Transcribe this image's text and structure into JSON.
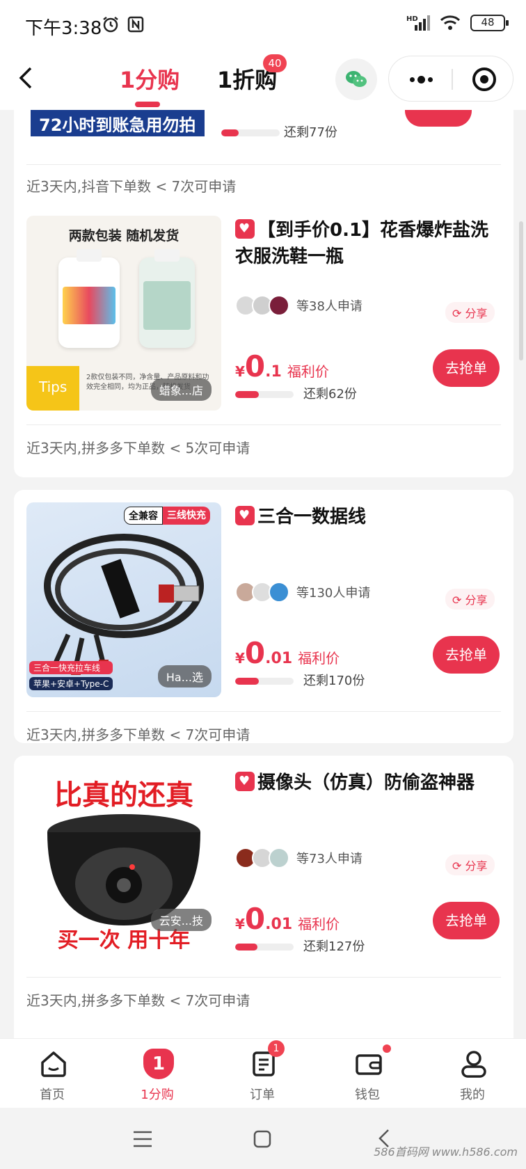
{
  "status_bar": {
    "time": "下午3:38",
    "battery": "48",
    "network": "HD"
  },
  "nav": {
    "tab_active": "1分购",
    "tab_other": "1折购",
    "tab_other_badge": "40"
  },
  "partial_card": {
    "banner_text": "72小时到账急用勿拍",
    "remaining": "还剩77份",
    "progress": 0.3,
    "condition": "近3天内,抖音下单数 < 7次可申请"
  },
  "products": [
    {
      "thumb_caption_top": "两款包装  随机发货",
      "thumb_tips": "Tips",
      "thumb_note": "2款仅包装不同，净含量、产品原料和功效完全相同，均为正品，随机发货",
      "shop": "蜡象...店",
      "title": "【到手价0.1】花香爆炸盐洗衣服洗鞋一瓶",
      "applicants": "等38人申请",
      "share": "分享",
      "price_yen": "¥",
      "price_big": "0",
      "price_small": ".1",
      "price_label": "福利价",
      "progress": 0.4,
      "remaining": "还剩62份",
      "button": "去抢单",
      "condition": "近3天内,拼多多下单数 < 5次可申请"
    },
    {
      "thumb_badge_a": "全兼容",
      "thumb_badge_b": "三线快充",
      "thumb_caption_a": "三合一快充拉车线",
      "thumb_caption_b": "苹果+安卓+Type-C",
      "shop": "Ha...选",
      "title": "三合一数据线",
      "applicants": "等130人申请",
      "share": "分享",
      "price_yen": "¥",
      "price_big": "0",
      "price_small": ".01",
      "price_label": "福利价",
      "progress": 0.4,
      "remaining": "还剩170份",
      "button": "去抢单",
      "condition": "近3天内,拼多多下单数 < 7次可申请"
    },
    {
      "thumb_text_top": "比真的还真",
      "thumb_text_bottom": "买一次 用十年",
      "shop": "云安...技",
      "title": "摄像头（仿真）防偷盗神器",
      "applicants": "等73人申请",
      "share": "分享",
      "price_yen": "¥",
      "price_big": "0",
      "price_small": ".01",
      "price_label": "福利价",
      "progress": 0.38,
      "remaining": "还剩127份",
      "button": "去抢单",
      "condition": "近3天内,拼多多下单数 < 7次可申请"
    }
  ],
  "tabbar": [
    {
      "label": "首页",
      "icon": "home-icon"
    },
    {
      "label": "1分购",
      "icon": "one-cent-icon",
      "active": true,
      "glyph": "1"
    },
    {
      "label": "订单",
      "icon": "order-icon",
      "badge": "1"
    },
    {
      "label": "钱包",
      "icon": "wallet-icon",
      "dot": true
    },
    {
      "label": "我的",
      "icon": "profile-icon"
    }
  ],
  "watermark": "586首码网 www.h586.com",
  "colors": {
    "accent": "#e8344e",
    "background": "#f3f3f3"
  }
}
